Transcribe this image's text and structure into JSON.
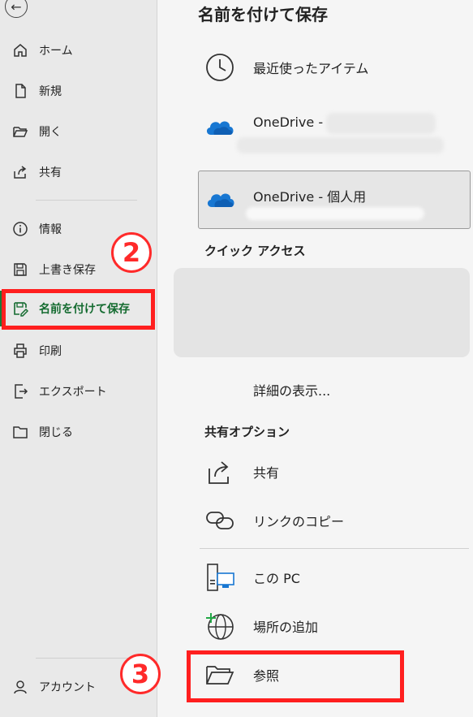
{
  "sidebar": {
    "items": [
      {
        "label": "ホーム",
        "icon": "home-icon"
      },
      {
        "label": "新規",
        "icon": "new-document-icon"
      },
      {
        "label": "開く",
        "icon": "open-folder-icon"
      },
      {
        "label": "共有",
        "icon": "share-icon"
      },
      {
        "label": "情報",
        "icon": "info-icon"
      },
      {
        "label": "上書き保存",
        "icon": "save-icon"
      },
      {
        "label": "名前を付けて保存",
        "icon": "save-as-icon"
      },
      {
        "label": "印刷",
        "icon": "print-icon"
      },
      {
        "label": "エクスポート",
        "icon": "export-icon"
      },
      {
        "label": "閉じる",
        "icon": "close-folder-icon"
      }
    ],
    "account_label": "アカウント"
  },
  "main": {
    "title": "名前を付けて保存",
    "recent_label": "最近使ったアイテム",
    "onedrive_business_label": "OneDrive -",
    "onedrive_personal_label": "OneDrive - 個人用",
    "quick_access_heading": "クイック アクセス",
    "more_label": "詳細の表示...",
    "share_options_heading": "共有オプション",
    "share_label": "共有",
    "copy_link_label": "リンクのコピー",
    "this_pc_label": "この PC",
    "add_place_label": "場所の追加",
    "browse_label": "参照"
  },
  "annotations": {
    "step2": "2",
    "step3": "3"
  },
  "colors": {
    "accent_green": "#146b30",
    "annotation_red": "#ff1f1f",
    "onedrive_blue": "#1877d2"
  }
}
